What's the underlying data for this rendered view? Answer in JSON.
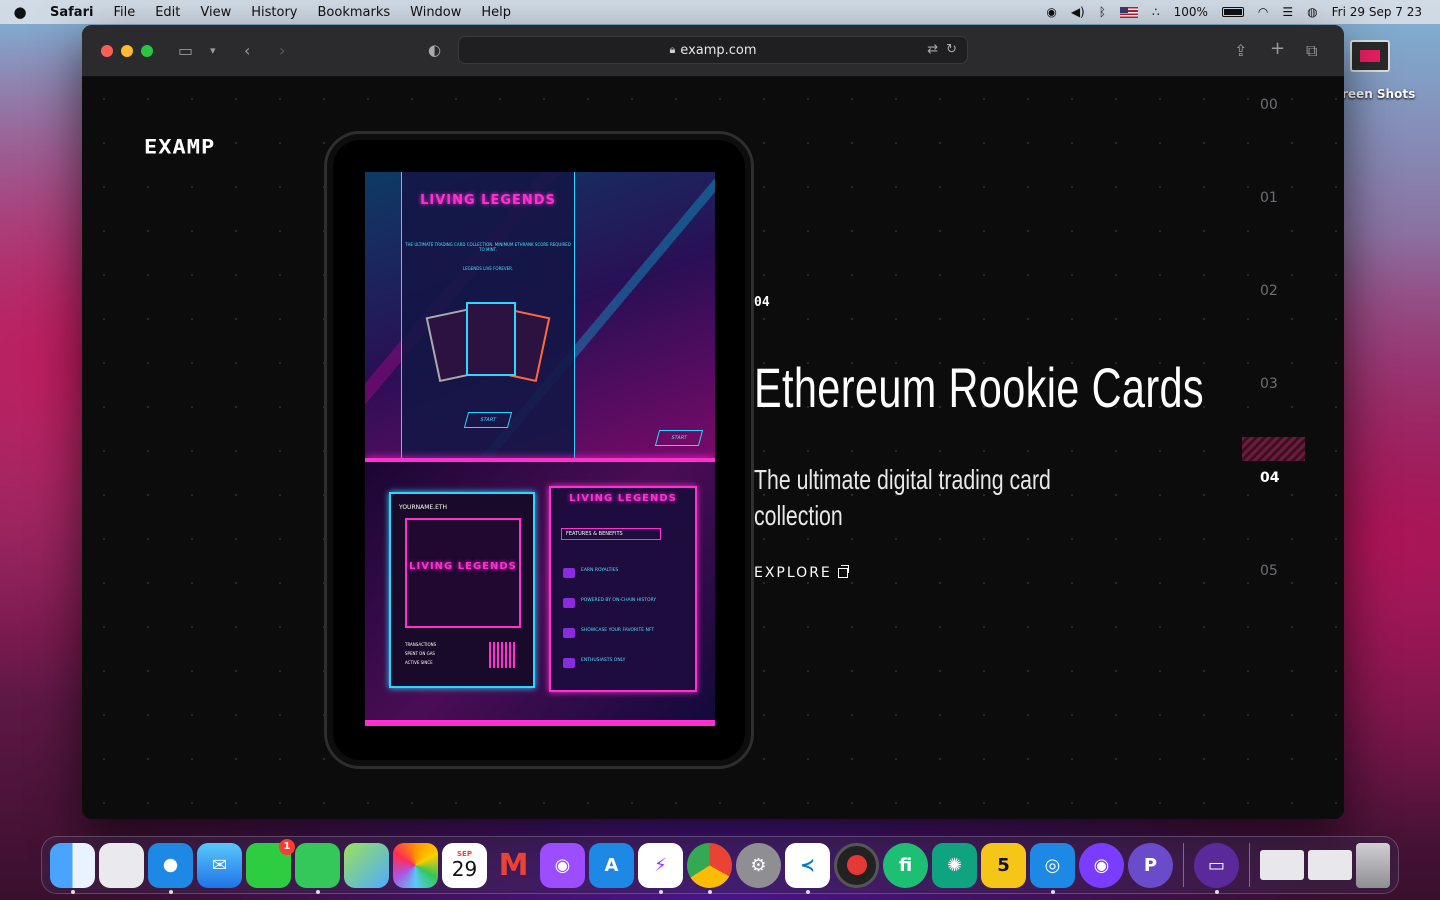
{
  "menubar": {
    "app_name": "Safari",
    "menus": [
      "File",
      "Edit",
      "View",
      "History",
      "Bookmarks",
      "Window",
      "Help"
    ],
    "battery": "100%",
    "clock": "Fri 29 Sep  7 23"
  },
  "desktop": {
    "folder_label": "reen Shots"
  },
  "browser": {
    "url": "examp.com"
  },
  "page": {
    "logo_text": "EXAMP",
    "slide_number": "04",
    "headline": "Ethereum Rookie Cards",
    "subline": "The ultimate digital trading card collection",
    "cta_label": "EXPLORE",
    "slide_nav": [
      "00",
      "01",
      "02",
      "03",
      "04",
      "05"
    ],
    "active_slide": "04"
  },
  "screen_mockup": {
    "brand": "LIVING LEGENDS",
    "tagline": "THE ULTIMATE TRADING CARD COLLECTION. MINIMUM ETHRANK SCORE REQUIRED TO MINT.",
    "motto": "LEGENDS LIVE FOREVER.",
    "start_label": "START",
    "card_name": "YOURNAME.ETH",
    "features_header": "FEATURES & BENEFITS",
    "features": [
      "EARN ROYALTIES",
      "POWERED BY ON-CHAIN HISTORY",
      "SHOWCASE YOUR FAVORITE NFT",
      "ENTHUSIASTS ONLY"
    ],
    "stats": [
      "TRANSACTIONS",
      "SPENT ON GAS",
      "ACTIVE SINCE"
    ]
  },
  "dock": {
    "calendar_month": "SEP",
    "calendar_day": "29",
    "facetime_badge": "1",
    "items": [
      "finder",
      "launchpad",
      "safari",
      "mail",
      "facetime",
      "messages",
      "maps",
      "photos",
      "calendar",
      "gmail",
      "podcasts",
      "app-store",
      "messenger",
      "chrome",
      "settings",
      "vscode",
      "record",
      "fiverr",
      "chatgpt",
      "five",
      "alpha",
      "pastel",
      "p-app",
      "drive",
      "window-1",
      "window-2",
      "trash"
    ]
  },
  "colors": {
    "accent_pink": "#ff2fd2",
    "accent_cyan": "#2ad7ff",
    "marker": "#6b1c3a"
  }
}
